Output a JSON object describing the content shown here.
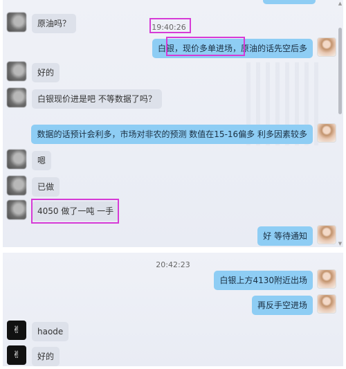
{
  "panel1": {
    "timestamp": "19:40:26",
    "messages": [
      {
        "side": "left",
        "text": "原油吗？"
      },
      {
        "side": "right",
        "text": "白银，现价多单进场，原油的话先空后多"
      },
      {
        "side": "left",
        "text": "好的"
      },
      {
        "side": "left",
        "text": "白银现价进是吧  不等数据了吗？"
      },
      {
        "side": "right",
        "text": "数据的话预计会利多，市场对非农的预测 数值在15-16偏多  利多因素较多"
      },
      {
        "side": "left",
        "text": "嗯"
      },
      {
        "side": "left",
        "text": "已做"
      },
      {
        "side": "left",
        "text": "4050  做了一吨 一手"
      },
      {
        "side": "right",
        "text": "好  等待通知"
      }
    ]
  },
  "panel2": {
    "timestamp": "20:42:23",
    "messages": [
      {
        "side": "right",
        "text": "白银上方4130附近出场"
      },
      {
        "side": "right",
        "text": "再反手空进场"
      },
      {
        "side": "left",
        "text": "haode"
      },
      {
        "side": "left",
        "text": "好的"
      }
    ]
  }
}
